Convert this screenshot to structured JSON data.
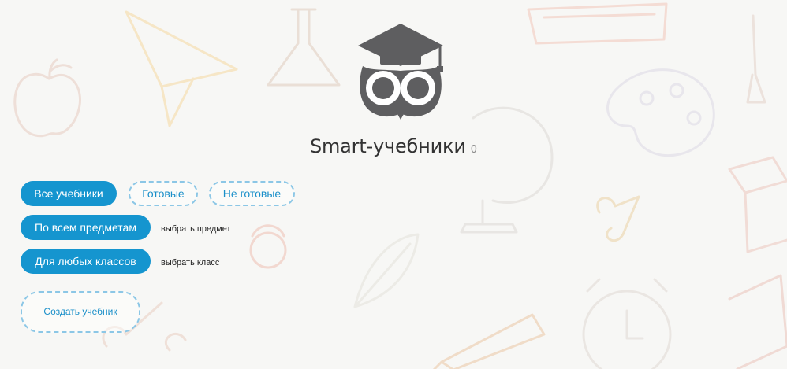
{
  "header": {
    "title": "Smart-учебники",
    "count": "0"
  },
  "filters": {
    "all_label": "Все учебники",
    "ready_label": "Готовые",
    "not_ready_label": "Не готовые",
    "subjects_label": "По всем предметам",
    "choose_subject": "выбрать предмет",
    "grades_label": "Для любых классов",
    "choose_grade": "выбрать класс"
  },
  "actions": {
    "create_label": "Создать учебник"
  },
  "colors": {
    "accent": "#1595cf",
    "dashed_border": "#8cc7e6",
    "logo": "#5e5e60"
  }
}
